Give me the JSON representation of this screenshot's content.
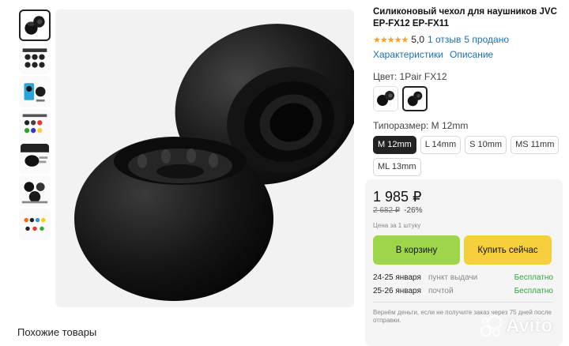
{
  "product": {
    "title": "Силиконовый чехол для наушников JVC EP-FX12 EP-FX11",
    "stars": "★★★★★",
    "rating": "5,0",
    "reviews_link": "1 отзыв",
    "sold": "5 продано",
    "tab_characteristics": "Характеристики",
    "tab_description": "Описание"
  },
  "color": {
    "label": "Цвет: 1Pair FX12",
    "swatches": [
      "swatch-1",
      "swatch-2"
    ]
  },
  "size": {
    "label": "Типоразмер: M 12mm",
    "options": [
      "M 12mm",
      "L 14mm",
      "S 10mm",
      "MS 11mm",
      "ML 13mm"
    ],
    "selected": "M 12mm"
  },
  "purchase": {
    "price": "1 985 ₽",
    "old_price": "2 682 ₽",
    "discount": "-26%",
    "per_unit": "Цена за 1 штуку",
    "cart_button": "В корзину",
    "buy_button": "Купить сейчас",
    "delivery": [
      {
        "dates": "24-25 января",
        "place": "пункт выдачи",
        "price": "Бесплатно"
      },
      {
        "dates": "25-26 января",
        "place": "почтой",
        "price": "Бесплатно"
      }
    ],
    "refund_note": "Вернём деньги, если не получите заказ через 75 дней после отправки."
  },
  "similar_label": "Похожие товары",
  "watermark": "Avito",
  "colors": {
    "accent_green": "#9dd64b",
    "accent_yellow": "#f5cf3c",
    "link_blue": "#1f6fb5",
    "star_orange": "#ff9f1a",
    "free_green": "#33a33c"
  }
}
